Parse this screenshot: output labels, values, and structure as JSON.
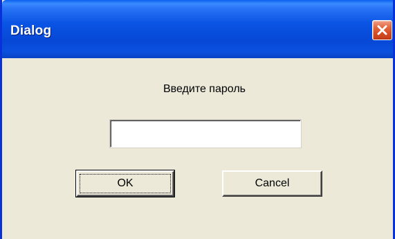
{
  "window": {
    "title": "Dialog",
    "close_icon": "close-icon"
  },
  "dialog": {
    "prompt": "Введите пароль",
    "password_value": "",
    "ok_label": "OK",
    "cancel_label": "Cancel"
  },
  "colors": {
    "titlebar": "#0a54e4",
    "client_background": "#ece9d8",
    "close_button": "#d24a22"
  }
}
